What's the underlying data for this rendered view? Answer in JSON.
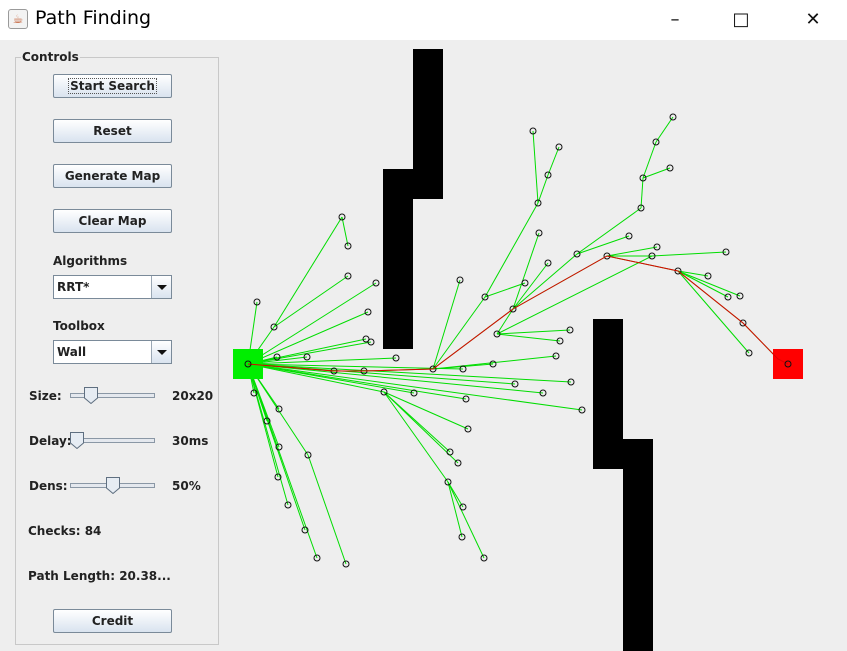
{
  "window": {
    "title": "Path Finding",
    "minimize_glyph": "–",
    "maximize_glyph": "□",
    "close_glyph": "✕",
    "app_icon": "java-icon"
  },
  "controls": {
    "legend": "Controls",
    "start_search": "Start Search",
    "reset": "Reset",
    "generate_map": "Generate Map",
    "clear_map": "Clear Map",
    "algorithms_label": "Algorithms",
    "algorithm_value": "RRT*",
    "toolbox_label": "Toolbox",
    "toolbox_value": "Wall",
    "size_label": "Size:",
    "size_value": "20x20",
    "size_level": 0.2,
    "delay_label": "Delay:",
    "delay_value": "30ms",
    "delay_level": 0.0,
    "dens_label": "Dens:",
    "dens_value": "50%",
    "dens_level": 0.5,
    "checks": "Checks: 84",
    "path_length": "Path Length: 20.38...",
    "credit": "Credit"
  },
  "colors": {
    "start": "#00ee00",
    "goal": "#ff0000",
    "wall": "#000000",
    "tree_edge": "#00dd00",
    "path": "#dd0000",
    "background": "#eeeeee"
  }
}
